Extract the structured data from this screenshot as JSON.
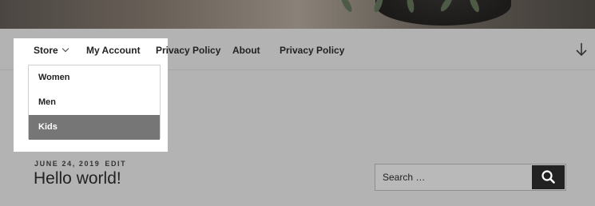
{
  "nav": {
    "items": [
      {
        "label": "Store"
      },
      {
        "label": "My Account"
      },
      {
        "label": "Privacy Policy"
      },
      {
        "label": "About"
      },
      {
        "label": "Privacy Policy"
      }
    ],
    "submenu": {
      "items": [
        {
          "label": "Women"
        },
        {
          "label": "Men"
        },
        {
          "label": "Kids"
        }
      ]
    }
  },
  "post": {
    "date": "JUNE 24, 2019",
    "edit_label": "EDIT",
    "title": "Hello world!"
  },
  "search": {
    "placeholder": "Search …"
  },
  "icons": {
    "store_dropdown": "chevron-down-icon",
    "scroll": "arrow-down-icon",
    "search": "search-icon"
  },
  "colors": {
    "overlay_bg": "#b3b3b3",
    "active_submenu_bg": "#767676",
    "search_button_bg": "#222222"
  }
}
